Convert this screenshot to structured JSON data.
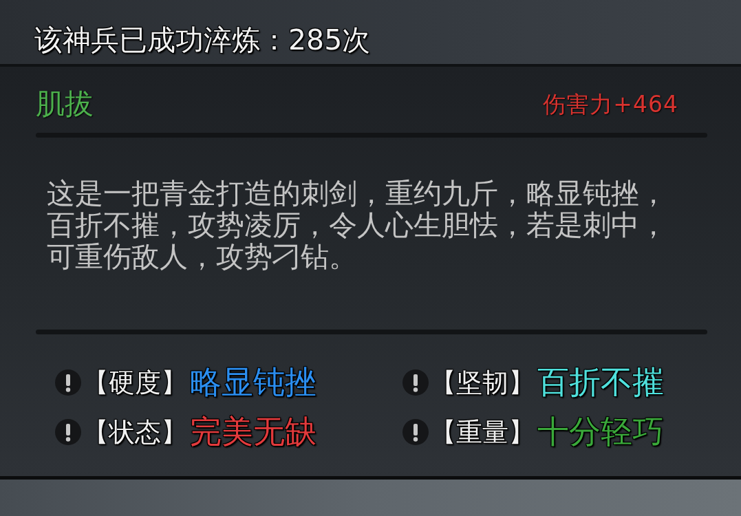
{
  "header": {
    "refine_count": "该神兵已成功淬炼：285次"
  },
  "item": {
    "name": "肌拔",
    "bonus": "伤害力+464",
    "description": "这是一把青金打造的刺剑，重约九斤，略显钝挫，百折不摧，攻势凌厉，令人心生胆怯，若是刺中，可重伤敌人，攻势刁钻。",
    "attributes": [
      {
        "label": "【硬度】",
        "value": "略显钝挫",
        "color": "#2b8ef0"
      },
      {
        "label": "【坚韧】",
        "value": "百折不摧",
        "color": "#4fe0dc"
      },
      {
        "label": "【状态】",
        "value": "完美无缺",
        "color": "#e23a3c"
      },
      {
        "label": "【重量】",
        "value": "十分轻巧",
        "color": "#3aa83a"
      }
    ]
  }
}
